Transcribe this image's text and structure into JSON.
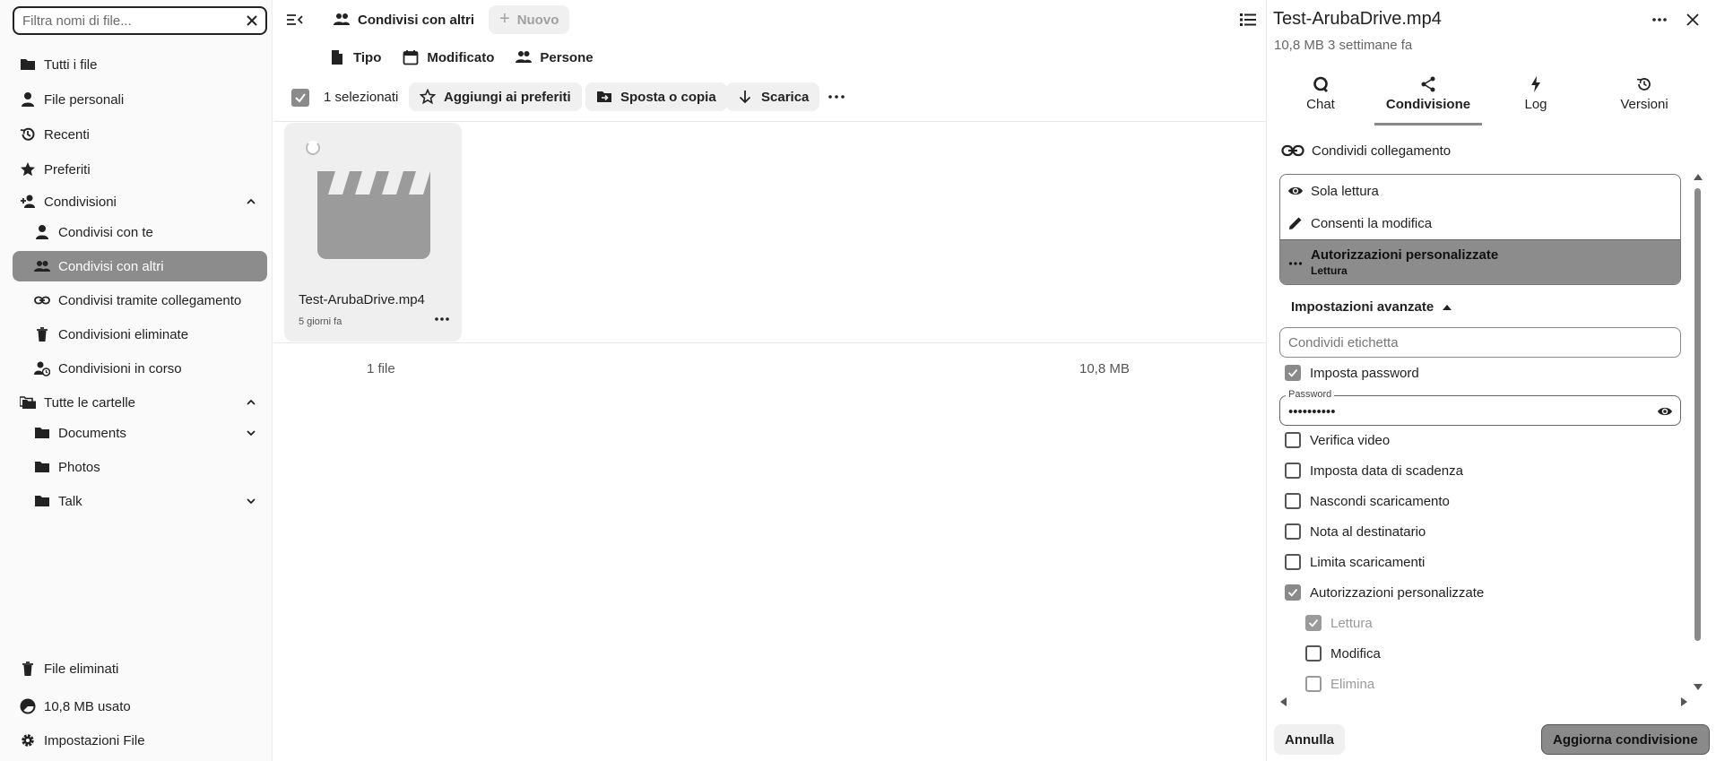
{
  "nav": {
    "filter_placeholder": "Filtra nomi di file...",
    "items": {
      "all_files": "Tutti i file",
      "personal": "File personali",
      "recent": "Recenti",
      "favorites": "Preferiti",
      "shares": "Condivisioni",
      "shared_with_you": "Condivisi con te",
      "shared_with_others": "Condivisi con altri",
      "shared_by_link": "Condivisi tramite collegamento",
      "deleted_shares": "Condivisioni eliminate",
      "pending_shares": "Condivisioni in corso",
      "all_folders": "Tutte le cartelle",
      "documents": "Documents",
      "photos": "Photos",
      "talk": "Talk",
      "deleted_files": "File eliminati",
      "quota": "10,8 MB usato",
      "settings": "Impostazioni File"
    }
  },
  "main": {
    "breadcrumb": "Condivisi con altri",
    "new_label": "Nuovo",
    "filters": {
      "type": "Tipo",
      "modified": "Modificato",
      "people": "Persone"
    },
    "selection": "1 selezionati",
    "actions": {
      "favorite": "Aggiungi ai preferiti",
      "move_copy": "Sposta o copia",
      "download": "Scarica"
    },
    "file": {
      "name": "Test-ArubaDrive.mp4",
      "date": "5 giorni fa"
    },
    "summary": {
      "count": "1 file",
      "size": "10,8 MB"
    }
  },
  "sidebar": {
    "title": "Test-ArubaDrive.mp4",
    "subtitle": "10,8 MB 3 settimane fa",
    "tabs": {
      "chat": "Chat",
      "sharing": "Condivisione",
      "log": "Log",
      "versions": "Versioni"
    },
    "share_link": "Condividi collegamento",
    "permissions": {
      "read_only": "Sola lettura",
      "allow_edit": "Consenti la modifica",
      "custom": "Autorizzazioni personalizzate",
      "custom_sub": "Lettura"
    },
    "advanced": "Impostazioni avanzate",
    "label_placeholder": "Condividi etichetta",
    "options": {
      "set_password": "Imposta password",
      "password_label": "Password",
      "password_value": "••••••••••",
      "video_verification": "Verifica video",
      "expiration": "Imposta data di scadenza",
      "hide_download": "Nascondi scaricamento",
      "note": "Nota al destinatario",
      "limit_downloads": "Limita scaricamenti",
      "custom_permissions": "Autorizzazioni personalizzate",
      "read": "Lettura",
      "edit": "Modifica",
      "delete": "Elimina"
    },
    "cancel": "Annulla",
    "update": "Aggiorna condivisione"
  }
}
